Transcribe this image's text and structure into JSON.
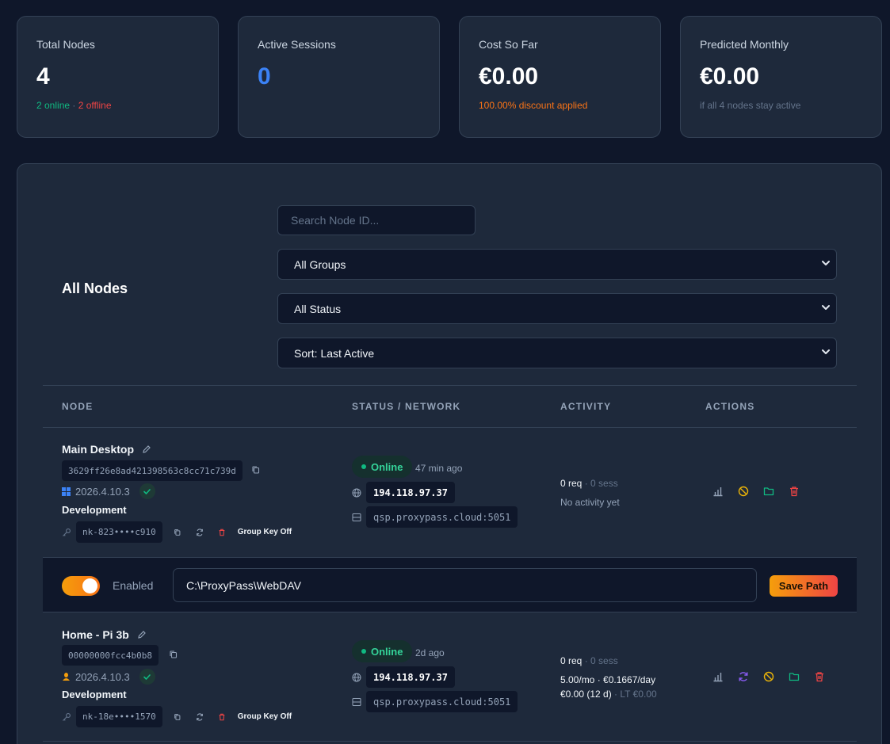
{
  "stats": [
    {
      "label": "Total Nodes",
      "value": "4",
      "sub_online": "2 online",
      "sub_sep": " · ",
      "sub_offline": "2 offline"
    },
    {
      "label": "Active Sessions",
      "value": "0"
    },
    {
      "label": "Cost So Far",
      "value": "€0.00",
      "sub": "100.00% discount applied"
    },
    {
      "label": "Predicted Monthly",
      "value": "€0.00",
      "sub": "if all 4 nodes stay active"
    }
  ],
  "filters": {
    "title": "All Nodes",
    "search_placeholder": "Search Node ID...",
    "group": "All Groups",
    "status": "All Status",
    "sort": "Sort: Last Active"
  },
  "columns": [
    "NODE",
    "STATUS / NETWORK",
    "ACTIVITY",
    "ACTIONS"
  ],
  "nodes": [
    {
      "name": "Main Desktop",
      "id": "3629ff26e8ad421398563c8cc71c739d",
      "os_icon": "windows-icon",
      "version": "2026.4.10.3",
      "group": "Development",
      "key": "nk-823••••c910",
      "group_key": "Group Key Off",
      "status": "Online",
      "last_seen": "47 min ago",
      "ip": "194.118.97.37",
      "host": "qsp.proxypass.cloud:5051",
      "req": "0 req",
      "sess": " · 0 sess",
      "activity": "No activity yet"
    },
    {
      "name": "Home - Pi 3b",
      "id": "00000000fcc4b0b8",
      "os_icon": "linux-icon",
      "version": "2026.4.10.3",
      "group": "Development",
      "key": "nk-18e••••1570",
      "group_key": "Group Key Off",
      "status": "Online",
      "last_seen": "2d ago",
      "ip": "194.118.97.37",
      "host": "qsp.proxypass.cloud:5051",
      "req": "0 req",
      "sess": " · 0 sess",
      "price": "5.00/mo · €0.1667/day",
      "cost": "€0.00 (12 d)",
      "lt": " · LT €0.00"
    }
  ],
  "webdav": {
    "enabled_label": "Enabled",
    "path": "C:\\ProxyPass\\WebDAV",
    "save_label": "Save Path"
  },
  "colors": {
    "online": "#10b981",
    "offline": "#ef4444",
    "accent": "#3b82f6",
    "discount": "#f97316"
  }
}
